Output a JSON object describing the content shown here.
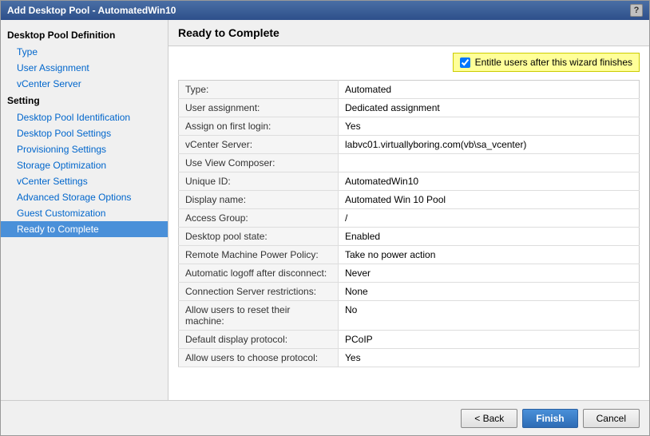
{
  "dialog": {
    "title": "Add Desktop Pool - AutomatedWin10",
    "help_button": "?"
  },
  "sidebar": {
    "section_definition": "Desktop Pool Definition",
    "items_definition": [
      {
        "label": "Type",
        "active": false
      },
      {
        "label": "User Assignment",
        "active": false
      },
      {
        "label": "vCenter Server",
        "active": false
      }
    ],
    "section_setting": "Setting",
    "items_setting": [
      {
        "label": "Desktop Pool Identification",
        "active": false
      },
      {
        "label": "Desktop Pool Settings",
        "active": false
      },
      {
        "label": "Provisioning Settings",
        "active": false
      },
      {
        "label": "Storage Optimization",
        "active": false
      },
      {
        "label": "vCenter Settings",
        "active": false
      },
      {
        "label": "Advanced Storage Options",
        "active": false
      },
      {
        "label": "Guest Customization",
        "active": false
      },
      {
        "label": "Ready to Complete",
        "active": true
      }
    ]
  },
  "main": {
    "header": "Ready to Complete",
    "entitle_checkbox_label": "Entitle users after this wizard finishes",
    "entitle_checked": true,
    "table_rows": [
      {
        "label": "Type:",
        "value": "Automated"
      },
      {
        "label": "User assignment:",
        "value": "Dedicated assignment"
      },
      {
        "label": "Assign on first login:",
        "value": "Yes"
      },
      {
        "label": "vCenter Server:",
        "value": "labvc01.virtuallyboring.com(vb\\sa_vcenter)"
      },
      {
        "label": "Use View Composer:",
        "value": ""
      },
      {
        "label": "Unique ID:",
        "value": "AutomatedWin10"
      },
      {
        "label": "Display name:",
        "value": "Automated Win 10 Pool"
      },
      {
        "label": "Access Group:",
        "value": "/"
      },
      {
        "label": "Desktop pool state:",
        "value": "Enabled"
      },
      {
        "label": "Remote Machine Power Policy:",
        "value": "Take no power action"
      },
      {
        "label": "Automatic logoff after disconnect:",
        "value": "Never"
      },
      {
        "label": "Connection Server restrictions:",
        "value": "None"
      },
      {
        "label": "Allow users to reset their machine:",
        "value": "No"
      },
      {
        "label": "Default display protocol:",
        "value": "PCoIP"
      },
      {
        "label": "Allow users to choose protocol:",
        "value": "Yes"
      }
    ]
  },
  "footer": {
    "back_label": "< Back",
    "finish_label": "Finish",
    "cancel_label": "Cancel"
  }
}
